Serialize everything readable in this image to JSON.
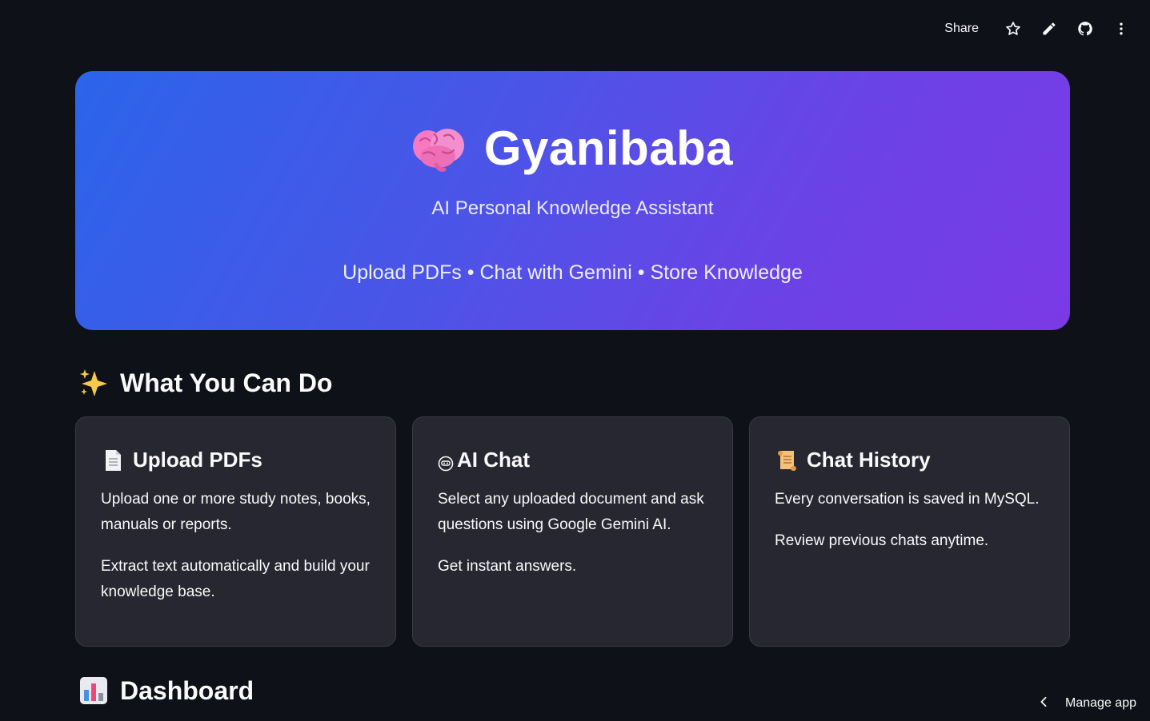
{
  "toolbar": {
    "share_label": "Share",
    "icons": [
      "star-icon",
      "pencil-icon",
      "github-icon",
      "more-vertical-icon"
    ]
  },
  "hero": {
    "title": "Gyanibaba",
    "subtitle": "AI Personal Knowledge Assistant",
    "tagline": "Upload PDFs • Chat with Gemini • Store Knowledge",
    "icon": "brain-icon"
  },
  "features_section": {
    "title": "What You Can Do",
    "icon": "sparkles-icon"
  },
  "cards": [
    {
      "title": "Upload PDFs",
      "icon": "document-icon",
      "paragraphs": [
        "Upload one or more study notes, books, manuals or reports.",
        "Extract text automatically and build your knowledge base."
      ]
    },
    {
      "title": "AI Chat",
      "icon": "robot-face-icon",
      "paragraphs": [
        "Select any uploaded document and ask questions using Google Gemini AI.",
        "Get instant answers."
      ]
    },
    {
      "title": "Chat History",
      "icon": "scroll-icon",
      "paragraphs": [
        "Every conversation is saved in MySQL.",
        "Review previous chats anytime."
      ]
    }
  ],
  "dashboard_section": {
    "title": "Dashboard",
    "icon": "bar-chart-icon"
  },
  "manage_app": {
    "label": "Manage app"
  },
  "colors": {
    "background": "#0e1117",
    "card": "#262730",
    "hero_gradient_start": "#2b64ea",
    "hero_gradient_end": "#7a3ae6"
  }
}
